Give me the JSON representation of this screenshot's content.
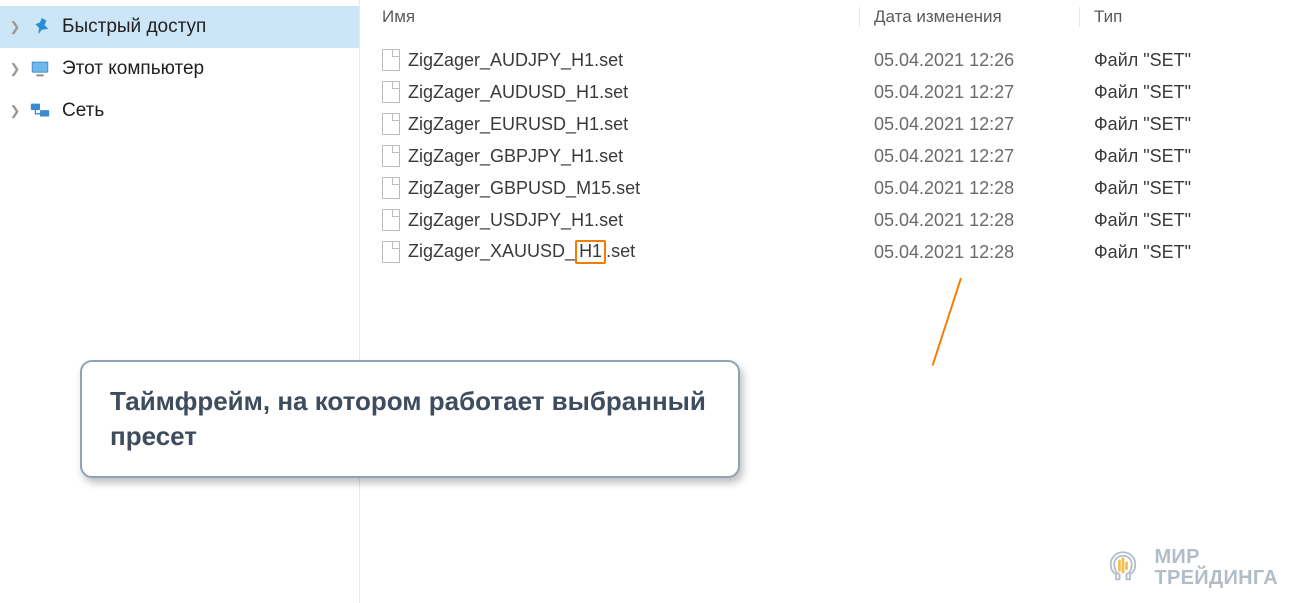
{
  "sidebar": {
    "items": [
      {
        "label": "Быстрый доступ",
        "selected": true,
        "icon": "pin"
      },
      {
        "label": "Этот компьютер",
        "selected": false,
        "icon": "pc"
      },
      {
        "label": "Сеть",
        "selected": false,
        "icon": "net"
      }
    ]
  },
  "columns": {
    "name": "Имя",
    "date": "Дата изменения",
    "type": "Тип"
  },
  "files": [
    {
      "name": "ZigZager_AUDJPY_H1.set",
      "date": "05.04.2021 12:26",
      "type": "Файл \"SET\""
    },
    {
      "name": "ZigZager_AUDUSD_H1.set",
      "date": "05.04.2021 12:27",
      "type": "Файл \"SET\""
    },
    {
      "name": "ZigZager_EURUSD_H1.set",
      "date": "05.04.2021 12:27",
      "type": "Файл \"SET\""
    },
    {
      "name": "ZigZager_GBPJPY_H1.set",
      "date": "05.04.2021 12:27",
      "type": "Файл \"SET\""
    },
    {
      "name": "ZigZager_GBPUSD_M15.set",
      "date": "05.04.2021 12:28",
      "type": "Файл \"SET\""
    },
    {
      "name": "ZigZager_USDJPY_H1.set",
      "date": "05.04.2021 12:28",
      "type": "Файл \"SET\""
    },
    {
      "name_pre": "ZigZager_XAUUSD_",
      "name_hl": "H1",
      "name_post": ".set",
      "date": "05.04.2021 12:28",
      "type": "Файл \"SET\"",
      "highlighted": true
    }
  ],
  "annotation": {
    "text": "Таймфрейм, на котором работает выбранный пресет"
  },
  "watermark": {
    "line1": "МИР",
    "line2": "ТРЕЙДИНГА"
  }
}
